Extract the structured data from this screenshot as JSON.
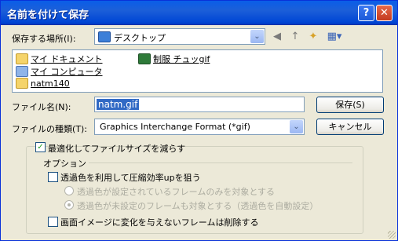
{
  "window": {
    "title": "名前を付けて保存",
    "help_label": "?",
    "close_label": "✕"
  },
  "save_location": {
    "label": "保存する場所(I):",
    "value": "デスクトップ",
    "arrow": "⌄"
  },
  "toolbar": {
    "back_icon": "◀",
    "up_icon": "↑",
    "newfolder_icon": "✦",
    "view_icon": "▦▾"
  },
  "files": [
    {
      "name": "マイ ドキュメント",
      "icon": "folder-docs-icon"
    },
    {
      "name": "マイ コンピュータ",
      "icon": "computer-icon"
    },
    {
      "name": "natm140",
      "icon": "folder-icon"
    },
    {
      "name": "制服 チュッgif",
      "icon": "gif-icon"
    }
  ],
  "filename": {
    "label": "ファイル名(N):",
    "value": "natm.gif"
  },
  "filetype": {
    "label": "ファイルの種類(T):",
    "value": "Graphics Interchange Format (*gif)"
  },
  "buttons": {
    "save": "保存(S)",
    "cancel": "キャンセル"
  },
  "optimize": {
    "label": "最適化してファイルサイズを減らす",
    "checked": true
  },
  "options_group": {
    "title": "オプション",
    "transparent": "透過色を利用して圧縮効率upを狙う",
    "radio1": "透過色が設定されているフレームのみを対象とする",
    "radio2": "透過色が未設定のフレームも対象とする（透過色を自動設定）",
    "delete_frames": "画面イメージに変化を与えないフレームは削除する"
  }
}
